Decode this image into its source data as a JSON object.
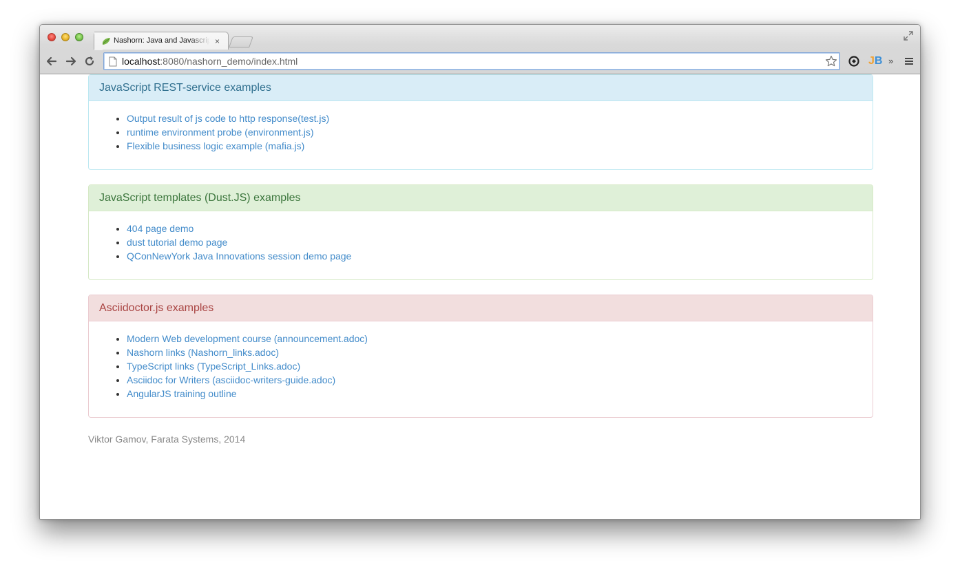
{
  "browser": {
    "tab_title": "Nashorn: Java and Javascript",
    "tab_close": "×",
    "url_host": "localhost",
    "url_path": ":8080/nashorn_demo/index.html",
    "overflow_chevron": "»",
    "ext_jb_j": "J",
    "ext_jb_b": "B"
  },
  "panels": [
    {
      "title": "JavaScript REST-service examples",
      "links": [
        "Output result of js code to http response(test.js)",
        "runtime environment probe (environment.js)",
        "Flexible business logic example (mafia.js)"
      ]
    },
    {
      "title": "JavaScript templates (Dust.JS) examples",
      "links": [
        "404 page demo",
        "dust tutorial demo page",
        "QConNewYork Java Innovations session demo page"
      ]
    },
    {
      "title": "Asciidoctor.js examples",
      "links": [
        "Modern Web development course (announcement.adoc)",
        "Nashorn links (Nashorn_links.adoc)",
        "TypeScript links (TypeScript_Links.adoc)",
        "Asciidoc for Writers (asciidoc-writers-guide.adoc)",
        "AngularJS training outline"
      ]
    }
  ],
  "footer": "Viktor Gamov, Farata Systems, 2014",
  "colors": {
    "link": "#428bca",
    "info_heading": "#31708f",
    "success_heading": "#3c763d",
    "danger_heading": "#a94442"
  }
}
